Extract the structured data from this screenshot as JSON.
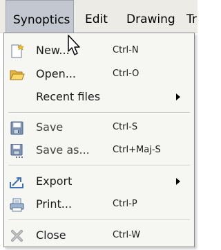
{
  "menubar": {
    "items": [
      {
        "label": "Synoptics"
      },
      {
        "label": "Edit"
      },
      {
        "label": "Drawing"
      },
      {
        "label": "Tr"
      }
    ]
  },
  "file_menu": {
    "items": [
      {
        "label": "New...",
        "shortcut": "Ctrl-N",
        "icon": "new-file-icon"
      },
      {
        "label": "Open...",
        "shortcut": "Ctrl-O",
        "icon": "open-folder-icon"
      },
      {
        "label": "Recent files",
        "shortcut": "",
        "submenu": true
      },
      {
        "label": "Save",
        "shortcut": "Ctrl-S",
        "icon": "save-icon"
      },
      {
        "label": "Save as...",
        "shortcut": "Ctrl+Maj-S",
        "icon": "save-as-icon"
      },
      {
        "label": "Export",
        "shortcut": "",
        "submenu": true,
        "icon": "export-icon"
      },
      {
        "label": "Print...",
        "shortcut": "Ctrl-P",
        "icon": "print-icon"
      },
      {
        "label": "Close",
        "shortcut": "Ctrl-W",
        "icon": "close-icon"
      }
    ]
  }
}
